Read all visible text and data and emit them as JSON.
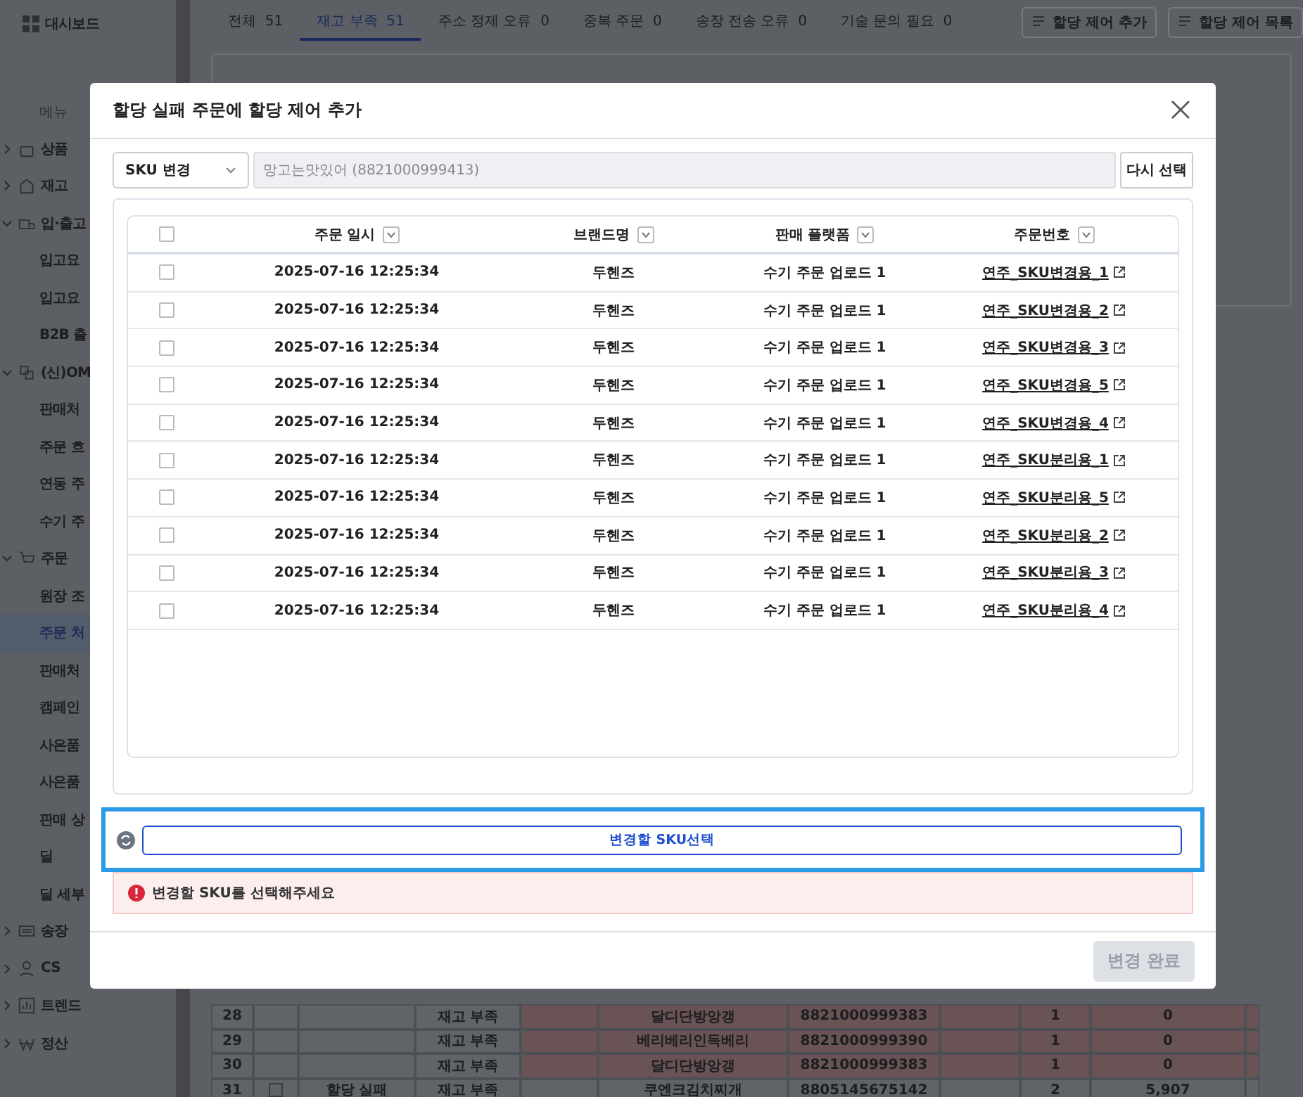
{
  "sidebar": {
    "top_item": "대시보드",
    "section_label": "메뉴",
    "groups": [
      {
        "label": "상품",
        "expanded": false
      },
      {
        "label": "재고",
        "expanded": false
      },
      {
        "label": "입·출고",
        "expanded": true,
        "children": [
          {
            "label": "입고요",
            "selected": false
          },
          {
            "label": "입고요",
            "selected": false
          },
          {
            "label": "B2B 출",
            "selected": false
          }
        ]
      },
      {
        "label": "(신)OM",
        "expanded": true,
        "children": [
          {
            "label": "판매처",
            "selected": false
          },
          {
            "label": "주문 흐",
            "selected": false
          },
          {
            "label": "연동 주",
            "selected": false
          },
          {
            "label": "수기 주",
            "selected": false
          }
        ]
      },
      {
        "label": "주문",
        "expanded": true,
        "children": [
          {
            "label": "원장 조",
            "selected": false
          },
          {
            "label": "주문 처",
            "selected": true
          },
          {
            "label": "판매처",
            "selected": false
          },
          {
            "label": "캠페인",
            "selected": false
          },
          {
            "label": "사은품",
            "selected": false
          },
          {
            "label": "사은품",
            "selected": false
          },
          {
            "label": "판매 상",
            "selected": false
          },
          {
            "label": "딜",
            "selected": false
          },
          {
            "label": "딜 세부",
            "selected": false
          }
        ]
      },
      {
        "label": "송장",
        "expanded": false
      },
      {
        "label": "CS",
        "expanded": false
      },
      {
        "label": "트렌드",
        "expanded": false
      },
      {
        "label": "정산",
        "expanded": false
      }
    ]
  },
  "tabs": [
    {
      "label": "전체",
      "count": "51",
      "selected": false
    },
    {
      "label": "재고 부족",
      "count": "51",
      "selected": true
    },
    {
      "label": "주소 정제 오류",
      "count": "0",
      "selected": false
    },
    {
      "label": "중복 주문",
      "count": "0",
      "selected": false
    },
    {
      "label": "송장 전송 오류",
      "count": "0",
      "selected": false
    },
    {
      "label": "기술 문의 필요",
      "count": "0",
      "selected": false
    }
  ],
  "toolbar_buttons": [
    "할당 제어 추가",
    "할당 제어 목록"
  ],
  "background_table": {
    "status": "할당 실패",
    "checked": false,
    "rows": [
      {
        "no": "28",
        "reason": "재고 부족",
        "product": "달디단방앙갱",
        "barcode": "8821000999383",
        "qty": "1",
        "stock": "0",
        "highlighted": true
      },
      {
        "no": "29",
        "reason": "재고 부족",
        "product": "베리베리인득베리",
        "barcode": "8821000999390",
        "qty": "1",
        "stock": "0",
        "highlighted": true
      },
      {
        "no": "30",
        "reason": "재고 부족",
        "product": "달디단방앙갱",
        "barcode": "8821000999383",
        "qty": "1",
        "stock": "0",
        "highlighted": true
      },
      {
        "no": "31",
        "reason": "재고 부족",
        "product": "쿠엔크김치찌개",
        "barcode": "8805145675142",
        "qty": "2",
        "stock": "5,907",
        "highlighted": false
      }
    ]
  },
  "modal": {
    "title": "할당 실패 주문에 할당 제어 추가",
    "mode_select": "SKU 변경",
    "sku_field": {
      "value": "망고는맛있어 (8821000999413)",
      "disabled": true
    },
    "reselect_button": "다시 선택",
    "table": {
      "select_all_checked": false,
      "columns": [
        "주문 일시",
        "브랜드명",
        "판매 플랫폼",
        "주문번호"
      ],
      "rows": [
        {
          "checked": false,
          "date": "2025-07-16 12:25:34",
          "brand": "두헨즈",
          "platform": "수기 주문 업로드 1",
          "order_no": "연주_SKU변경용_1"
        },
        {
          "checked": false,
          "date": "2025-07-16 12:25:34",
          "brand": "두헨즈",
          "platform": "수기 주문 업로드 1",
          "order_no": "연주_SKU변경용_2"
        },
        {
          "checked": false,
          "date": "2025-07-16 12:25:34",
          "brand": "두헨즈",
          "platform": "수기 주문 업로드 1",
          "order_no": "연주_SKU변경용_3"
        },
        {
          "checked": false,
          "date": "2025-07-16 12:25:34",
          "brand": "두헨즈",
          "platform": "수기 주문 업로드 1",
          "order_no": "연주_SKU변경용_5"
        },
        {
          "checked": false,
          "date": "2025-07-16 12:25:34",
          "brand": "두헨즈",
          "platform": "수기 주문 업로드 1",
          "order_no": "연주_SKU변경용_4"
        },
        {
          "checked": false,
          "date": "2025-07-16 12:25:34",
          "brand": "두헨즈",
          "platform": "수기 주문 업로드 1",
          "order_no": "연주_SKU분리용_1"
        },
        {
          "checked": false,
          "date": "2025-07-16 12:25:34",
          "brand": "두헨즈",
          "platform": "수기 주문 업로드 1",
          "order_no": "연주_SKU분리용_5"
        },
        {
          "checked": false,
          "date": "2025-07-16 12:25:34",
          "brand": "두헨즈",
          "platform": "수기 주문 업로드 1",
          "order_no": "연주_SKU분리용_2"
        },
        {
          "checked": false,
          "date": "2025-07-16 12:25:34",
          "brand": "두헨즈",
          "platform": "수기 주문 업로드 1",
          "order_no": "연주_SKU분리용_3"
        },
        {
          "checked": false,
          "date": "2025-07-16 12:25:34",
          "brand": "두헨즈",
          "platform": "수기 주문 업로드 1",
          "order_no": "연주_SKU분리용_4"
        }
      ]
    },
    "select_sku_button": {
      "label": "변경할 SKU선택",
      "highlighted": true
    },
    "error": "변경할 SKU를 선택해주세요",
    "submit_button": {
      "label": "변경 완료",
      "disabled": true
    }
  }
}
